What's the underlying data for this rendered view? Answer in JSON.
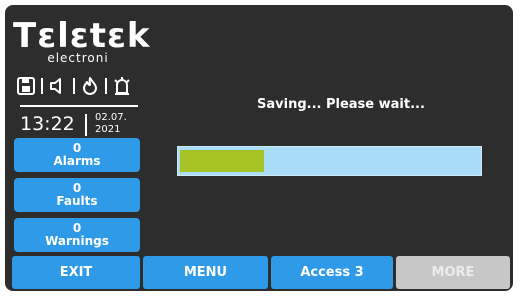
{
  "brand": {
    "name": "Tεlεtεk",
    "subtitle": "electroni"
  },
  "status_icons": [
    "floppy-disk-icon",
    "speaker-icon",
    "fire-icon",
    "siren-icon"
  ],
  "clock": {
    "time": "13:22",
    "date_line1": "02.07.",
    "date_line2": "2021"
  },
  "counters": [
    {
      "count": "0",
      "label": "Alarms"
    },
    {
      "count": "0",
      "label": "Faults"
    },
    {
      "count": "0",
      "label": "Warnings"
    }
  ],
  "main": {
    "message": "Saving... Please wait...",
    "progress_percent": 28
  },
  "footer": {
    "exit_label": "EXIT",
    "menu_label": "MENU",
    "access_label": "Access 3",
    "more_label": "MORE"
  },
  "colors": {
    "screen_bg": "#2d2d2d",
    "button_blue": "#2f9ae8",
    "button_disabled": "#c7c7c7",
    "progress_track": "#a8dcf7",
    "progress_fill": "#a6c224"
  }
}
